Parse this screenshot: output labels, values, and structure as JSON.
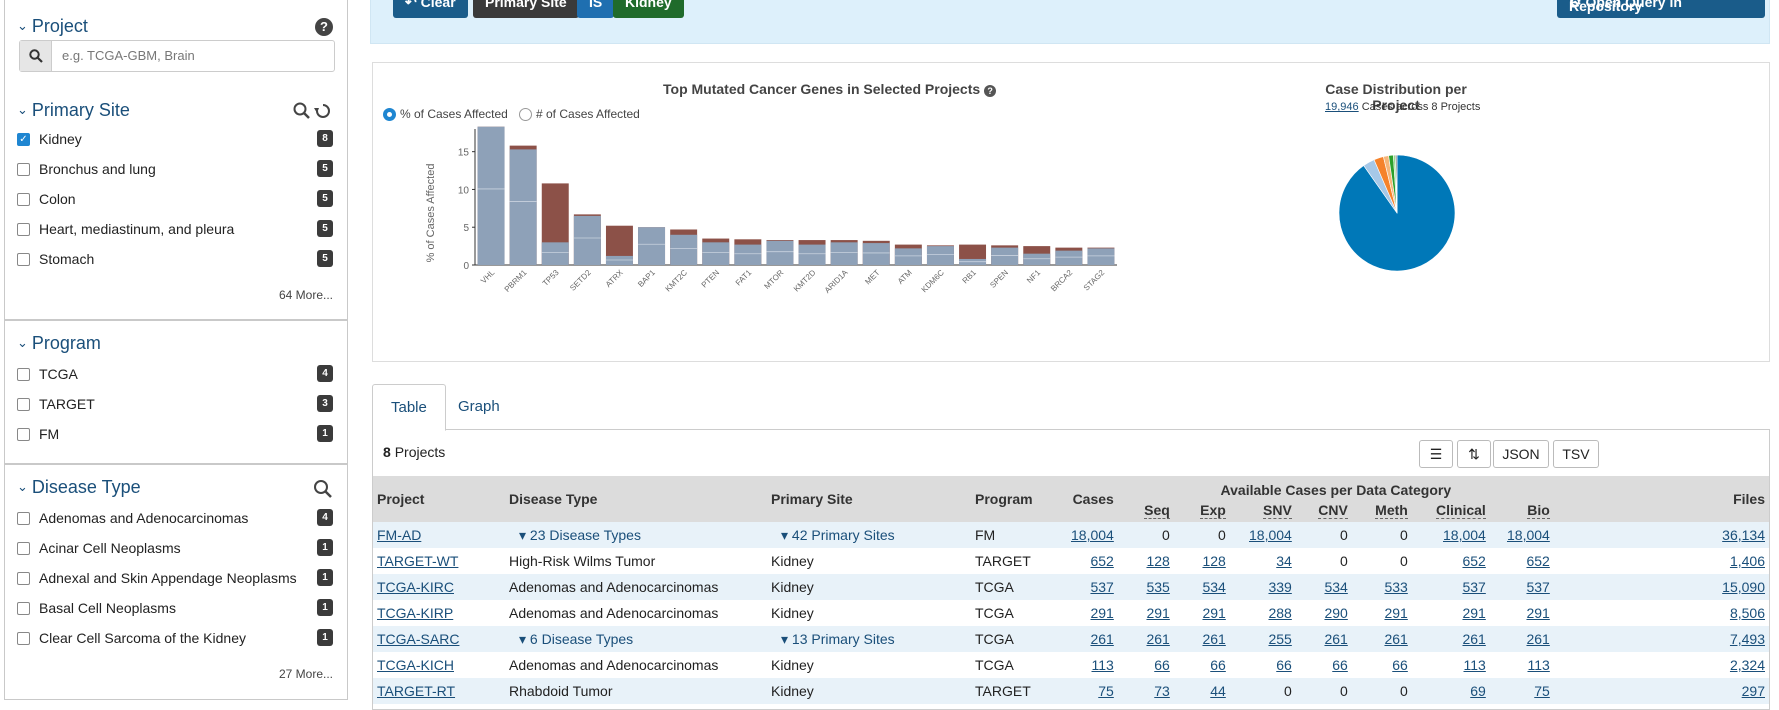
{
  "sidebar": {
    "project": {
      "title": "Project",
      "help": "?",
      "placeholder": "e.g. TCGA-GBM, Brain"
    },
    "primary_site": {
      "title": "Primary Site",
      "items": [
        {
          "label": "Kidney",
          "count": "8",
          "checked": true
        },
        {
          "label": "Bronchus and lung",
          "count": "5",
          "checked": false
        },
        {
          "label": "Colon",
          "count": "5",
          "checked": false
        },
        {
          "label": "Heart, mediastinum, and pleura",
          "count": "5",
          "checked": false
        },
        {
          "label": "Stomach",
          "count": "5",
          "checked": false
        }
      ],
      "more": "64 More..."
    },
    "program": {
      "title": "Program",
      "items": [
        {
          "label": "TCGA",
          "count": "4"
        },
        {
          "label": "TARGET",
          "count": "3"
        },
        {
          "label": "FM",
          "count": "1"
        }
      ]
    },
    "disease_type": {
      "title": "Disease Type",
      "items": [
        {
          "label": "Adenomas and Adenocarcinomas",
          "count": "4"
        },
        {
          "label": "Acinar Cell Neoplasms",
          "count": "1"
        },
        {
          "label": "Adnexal and Skin Appendage Neoplasms",
          "count": "1"
        },
        {
          "label": "Basal Cell Neoplasms",
          "count": "1"
        },
        {
          "label": "Clear Cell Sarcoma of the Kidney",
          "count": "1"
        }
      ],
      "more": "27 More..."
    }
  },
  "query_bar": {
    "clear": "Clear",
    "primary_site": "Primary Site",
    "is": "IS",
    "kidney": "Kidney",
    "open_repo": "Open Query in Repository",
    "colors": {
      "clear": "#1a5c8a",
      "primary_site": "#3a3a3a",
      "is": "#1f6fb0",
      "kidney": "#1f6b2b"
    }
  },
  "bar_chart_panel": {
    "title": "Top Mutated Cancer Genes in Selected Projects",
    "radio_pct": "% of Cases Affected",
    "radio_num": "# of Cases Affected"
  },
  "chart_data": [
    {
      "type": "bar",
      "title": "Top Mutated Cancer Genes in Selected Projects",
      "ylabel": "% of Cases Affected",
      "ylim": [
        0,
        18
      ],
      "yticks": [
        "0",
        "5",
        "10",
        "15"
      ],
      "categories": [
        "VHL",
        "PBRM1",
        "TP53",
        "SETD2",
        "ATRX",
        "BAP1",
        "KMT2C",
        "PTEN",
        "FAT1",
        "MTOR",
        "KMT2D",
        "ARID1A",
        "MET",
        "ATM",
        "KDM6C",
        "RB1",
        "SPEN",
        "NF1",
        "BRCA2",
        "STAG2"
      ],
      "series": [
        {
          "values": [
            18.3,
            15.8,
            10.8,
            6.7,
            5.2,
            5.0,
            4.7,
            3.5,
            3.4,
            3.3,
            3.3,
            3.3,
            3.2,
            2.7,
            2.6,
            2.7,
            2.6,
            2.5,
            2.3,
            2.3
          ],
          "color": "#8c5148"
        },
        {
          "values": [
            18.3,
            15.3,
            3.0,
            6.5,
            1.2,
            5.0,
            4.0,
            3.0,
            2.7,
            3.2,
            2.7,
            3.0,
            2.9,
            2.2,
            2.5,
            0.8,
            2.3,
            1.5,
            1.9,
            2.2
          ],
          "color": "#8ea1b8"
        }
      ]
    },
    {
      "type": "pie",
      "title": "Case Distribution per Project",
      "values": [
        18004,
        652,
        537,
        291,
        261,
        113,
        75,
        13
      ],
      "colors": [
        "#0078b8",
        "#a6c8e8",
        "#f5822a",
        "#f5b67a",
        "#2ca02c",
        "#98df8a",
        "#5a5a5a",
        "#c8c8c8"
      ]
    }
  ],
  "pie_panel": {
    "title": "Case Distribution per Project",
    "total": "19,946",
    "subtitle": "Cases across 8 Projects"
  },
  "tabs": [
    "Table",
    "Graph"
  ],
  "table": {
    "count": "8",
    "count_label": "Projects",
    "json": "JSON",
    "tsv": "TSV",
    "group_header": "Available Cases per Data Category",
    "headers": {
      "project": "Project",
      "disease": "Disease Type",
      "site": "Primary Site",
      "program": "Program",
      "cases": "Cases",
      "seq": "Seq",
      "exp": "Exp",
      "snv": "SNV",
      "cnv": "CNV",
      "meth": "Meth",
      "clinical": "Clinical",
      "bio": "Bio",
      "files": "Files"
    },
    "rows": [
      {
        "project": "FM-AD",
        "disease": "23 Disease Types",
        "site": "42 Primary Sites",
        "program": "FM",
        "cases": "18,004",
        "seq": "0",
        "exp": "0",
        "snv": "18,004",
        "cnv": "0",
        "meth": "0",
        "clinical": "18,004",
        "bio": "18,004",
        "files": "36,134",
        "expand": true
      },
      {
        "project": "TARGET-WT",
        "disease": "High-Risk Wilms Tumor",
        "site": "Kidney",
        "program": "TARGET",
        "cases": "652",
        "seq": "128",
        "exp": "128",
        "snv": "34",
        "cnv": "0",
        "meth": "0",
        "clinical": "652",
        "bio": "652",
        "files": "1,406",
        "expand": false
      },
      {
        "project": "TCGA-KIRC",
        "disease": "Adenomas and Adenocarcinomas",
        "site": "Kidney",
        "program": "TCGA",
        "cases": "537",
        "seq": "535",
        "exp": "534",
        "snv": "339",
        "cnv": "534",
        "meth": "533",
        "clinical": "537",
        "bio": "537",
        "files": "15,090",
        "expand": false
      },
      {
        "project": "TCGA-KIRP",
        "disease": "Adenomas and Adenocarcinomas",
        "site": "Kidney",
        "program": "TCGA",
        "cases": "291",
        "seq": "291",
        "exp": "291",
        "snv": "288",
        "cnv": "290",
        "meth": "291",
        "clinical": "291",
        "bio": "291",
        "files": "8,506",
        "expand": false
      },
      {
        "project": "TCGA-SARC",
        "disease": "6 Disease Types",
        "site": "13 Primary Sites",
        "program": "TCGA",
        "cases": "261",
        "seq": "261",
        "exp": "261",
        "snv": "255",
        "cnv": "261",
        "meth": "261",
        "clinical": "261",
        "bio": "261",
        "files": "7,493",
        "expand": true
      },
      {
        "project": "TCGA-KICH",
        "disease": "Adenomas and Adenocarcinomas",
        "site": "Kidney",
        "program": "TCGA",
        "cases": "113",
        "seq": "66",
        "exp": "66",
        "snv": "66",
        "cnv": "66",
        "meth": "66",
        "clinical": "113",
        "bio": "113",
        "files": "2,324",
        "expand": false
      },
      {
        "project": "TARGET-RT",
        "disease": "Rhabdoid Tumor",
        "site": "Kidney",
        "program": "TARGET",
        "cases": "75",
        "seq": "73",
        "exp": "44",
        "snv": "0",
        "cnv": "0",
        "meth": "0",
        "clinical": "69",
        "bio": "75",
        "files": "297",
        "expand": false
      }
    ]
  }
}
